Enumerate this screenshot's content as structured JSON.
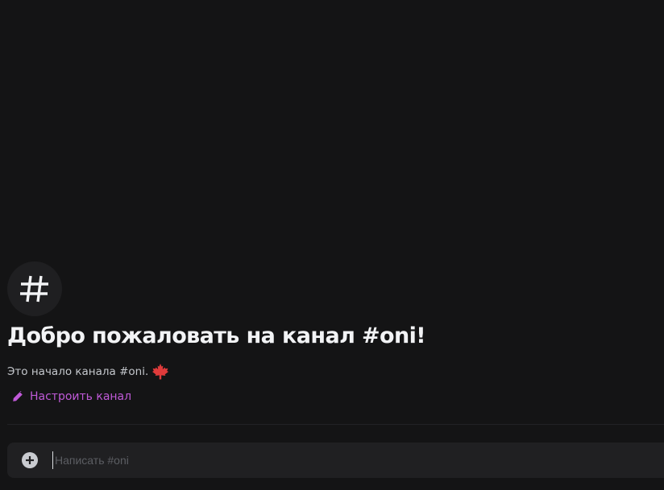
{
  "channel": {
    "icon": "hashtag-icon",
    "name": "#oni"
  },
  "welcome": {
    "title": "Добро пожаловать на канал #oni!",
    "subtitle": "Это начало канала #oni.",
    "subtitle_emoji": "maple-leaf-icon"
  },
  "actions": {
    "setup_icon": "pencil-icon",
    "setup_label": "Настроить канал"
  },
  "composer": {
    "add_icon": "plus-circle-icon",
    "placeholder": "Написать #oni",
    "value": ""
  },
  "colors": {
    "background": "#141415",
    "accent": "#c05ad8",
    "leaf": "#e03b3b"
  }
}
